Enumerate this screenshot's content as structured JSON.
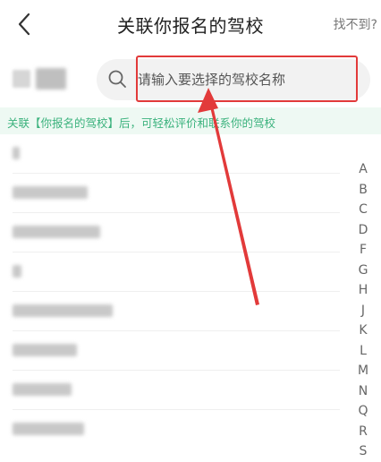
{
  "header": {
    "back_icon": "chevron-left-icon",
    "title": "关联你报名的驾校",
    "not_found": "找不到?"
  },
  "search": {
    "icon": "search-icon",
    "placeholder": "请输入要选择的驾校名称"
  },
  "banner": {
    "text": "关联【你报名的驾校】后，可轻松评价和联系你的驾校"
  },
  "annotation": {
    "highlight_color": "#e23a3a"
  },
  "alphabet": [
    "A",
    "B",
    "C",
    "D",
    "F",
    "G",
    "H",
    "J",
    "K",
    "L",
    "M",
    "N",
    "Q",
    "R",
    "S"
  ]
}
